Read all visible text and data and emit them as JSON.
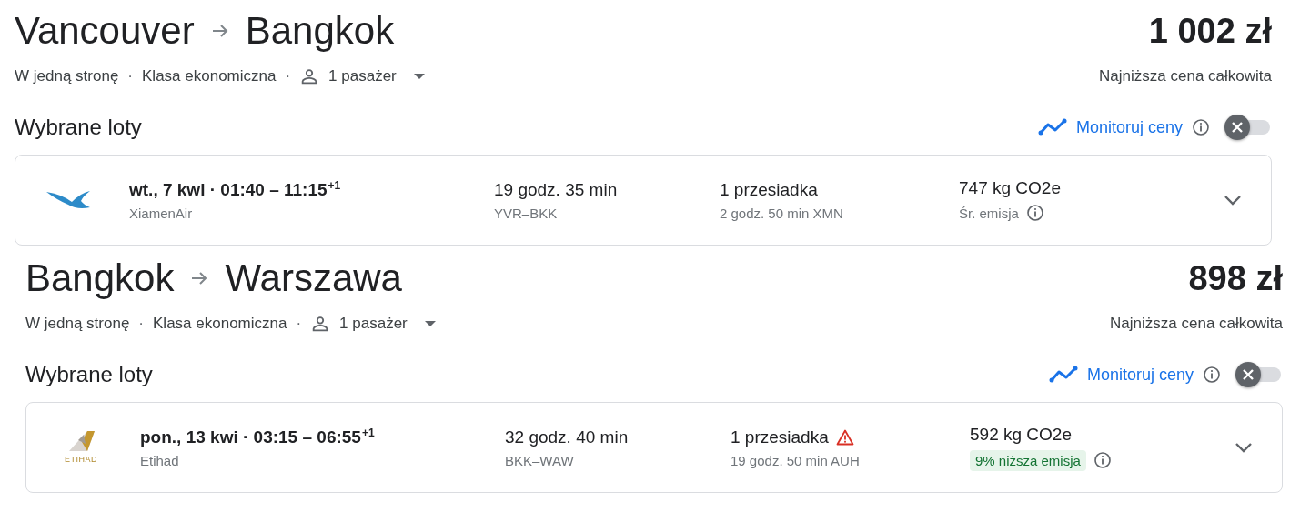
{
  "trips": [
    {
      "origin": "Vancouver",
      "destination": "Bangkok",
      "price": "1 002 zł",
      "trip_type": "W jedną stronę",
      "separator": "·",
      "cabin": "Klasa ekonomiczna",
      "passengers": "1 pasażer",
      "price_note": "Najniższa cena całkowita",
      "section_title": "Wybrane loty",
      "track_label": "Monitoruj ceny",
      "track_on": false,
      "flight": {
        "logo": {
          "kind": "bird"
        },
        "date": "wt., 7 kwi",
        "date_separator": "·",
        "times": "01:40 – 11:15",
        "day_offset": "+1",
        "airline": "XiamenAir",
        "duration": "19 godz. 35 min",
        "route": "YVR–BKK",
        "stops": "1 przesiadka",
        "stop_warning": false,
        "layover": "2 godz. 50 min XMN",
        "emissions": "747 kg CO2e",
        "emission_note": "Śr. emisja",
        "emission_lower": false
      }
    },
    {
      "origin": "Bangkok",
      "destination": "Warszawa",
      "price": "898 zł",
      "trip_type": "W jedną stronę",
      "separator": "·",
      "cabin": "Klasa ekonomiczna",
      "passengers": "1 pasażer",
      "price_note": "Najniższa cena całkowita",
      "section_title": "Wybrane loty",
      "track_label": "Monitoruj ceny",
      "track_on": false,
      "flight": {
        "logo": {
          "kind": "tail",
          "text": "ETIHAD"
        },
        "date": "pon., 13 kwi",
        "date_separator": "·",
        "times": "03:15 – 06:55",
        "day_offset": "+1",
        "airline": "Etihad",
        "duration": "32 godz. 40 min",
        "route": "BKK–WAW",
        "stops": "1 przesiadka",
        "stop_warning": true,
        "layover": "19 godz. 50 min AUH",
        "emissions": "592 kg CO2e",
        "emission_note": "9% niższa emisja",
        "emission_lower": true
      }
    }
  ]
}
